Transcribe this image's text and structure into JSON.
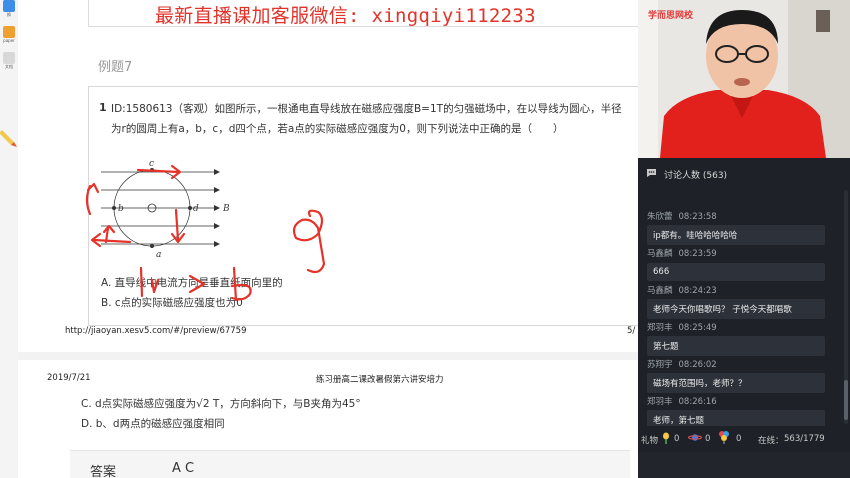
{
  "watermark": {
    "text": "最新直播课加客服微信: xingqiyi112233"
  },
  "toolbar": {
    "items": [
      "换",
      "paper",
      "文档"
    ]
  },
  "page1": {
    "example_title": "例题7",
    "question": {
      "number": "1",
      "text": "ID:1580613（客观）如图所示，一根通电直导线放在磁感应强度B=1T的匀强磁场中，在以导线为圆心，半径为r的圆周上有a，b，c，d四个点，若a点的实际磁感应强度为0，则下列说法中正确的是（　　）",
      "options": [
        "A. 直导线中电流方向是垂直纸面向里的",
        "B. c点的实际磁感应强度也为0"
      ],
      "diagram_labels": {
        "c": "c",
        "b": "b",
        "d": "d",
        "a": "a",
        "B": "B"
      }
    },
    "url": "http://jiaoyan.xesv5.com/#/preview/67759",
    "page_number": "5/"
  },
  "page2": {
    "date": "2019/7/21",
    "header": "练习册高二课改暑假第六讲安培力",
    "options": [
      "C. d点实际磁感应强度为√2 T，方向斜向下，与B夹角为45°",
      "D. b、d两点的磁感应强度相同"
    ],
    "answer_label": "答案",
    "answer_value": "A C"
  },
  "panel": {
    "brand": "学而思网校",
    "chat_title": "讨论人数 (563)",
    "messages": [
      {
        "user": "朱欣蕾",
        "time": "08:23:58",
        "text": "ip都有。哇哈哈哈哈哈"
      },
      {
        "user": "马鑫麟",
        "time": "08:23:59",
        "text": "666"
      },
      {
        "user": "马鑫麟",
        "time": "08:24:23",
        "text": "老师今天你唱歌吗？ 子悦今天都唱歌"
      },
      {
        "user": "郑羽丰",
        "time": "08:25:49",
        "text": "第七题"
      },
      {
        "user": "苏翔宇",
        "time": "08:26:02",
        "text": "磁场有范围吗，老师？？"
      },
      {
        "user": "郑羽丰",
        "time": "08:26:16",
        "text": "老师，第七题"
      }
    ],
    "gift_label": "礼物",
    "gift_counts": [
      "0",
      "0",
      "0"
    ],
    "online_label": "在线：",
    "online_value": "563/1779"
  },
  "colors": {
    "watermark": "#e2332b",
    "panel_bg": "#1e2228",
    "bubble_bg": "#2d323a",
    "pen_red": "#e5332a"
  }
}
